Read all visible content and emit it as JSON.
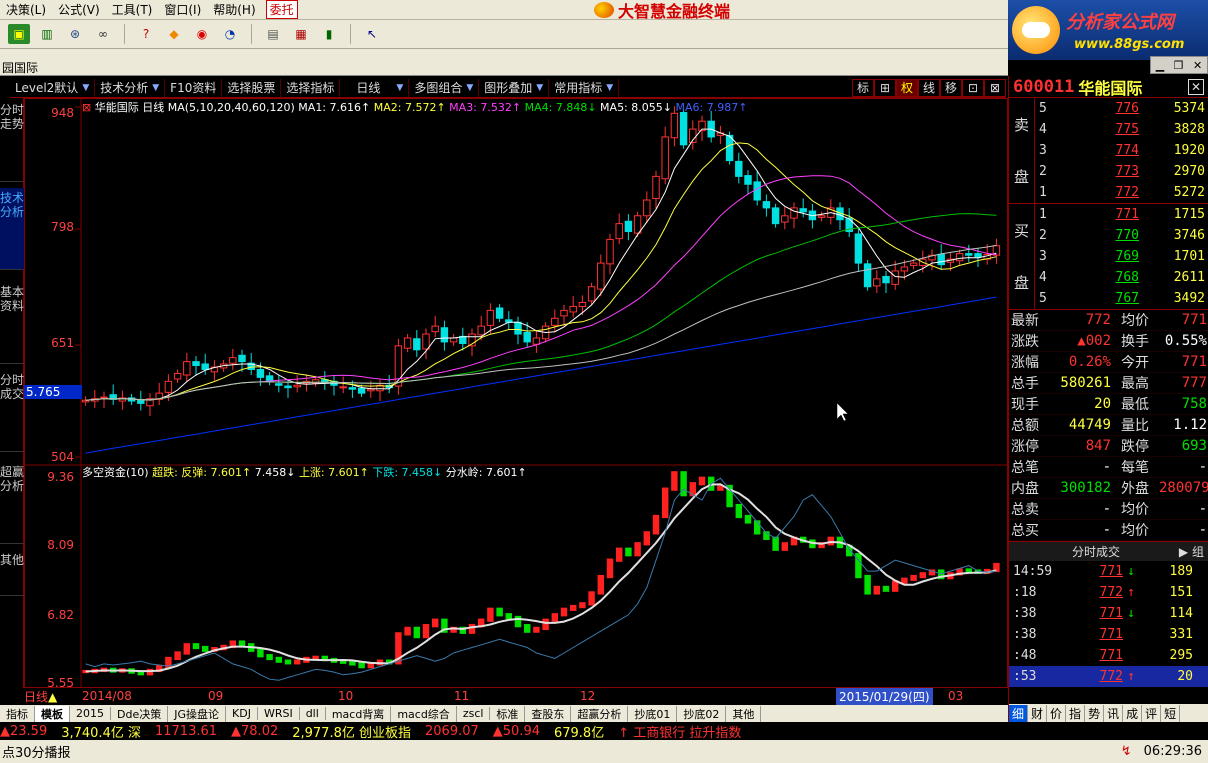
{
  "menu": {
    "items": [
      "决策(L)",
      "公式(V)",
      "工具(T)",
      "窗口(I)",
      "帮助(H)"
    ],
    "entrust": "委托"
  },
  "brand": {
    "title": "大智慧金融终端"
  },
  "ad": {
    "line1": "分析家公式网",
    "line2": "www.88gs.com"
  },
  "tabs": {
    "ghost": "园国际"
  },
  "toolbar": {
    "icons": [
      "monitor-icon",
      "stock-icon",
      "radar-icon",
      "binoculars-icon",
      "help-icon",
      "diamond-icon",
      "ring-icon",
      "f10-icon",
      "document-icon",
      "layout-icon",
      "bars-icon",
      "cursor-help-icon"
    ]
  },
  "chart_toolbar": {
    "items": [
      "Level2默认",
      "技术分析",
      "F10资料",
      "选择股票",
      "选择指标",
      "日线",
      "多图组合",
      "图形叠加",
      "常用指标"
    ],
    "buttons": [
      "标",
      "⊞",
      "权",
      "线",
      "移",
      "⊡",
      "⊠"
    ]
  },
  "side_tabs": [
    "分时走势",
    "技术分析",
    "基本资料",
    "分时成交",
    "超赢分析",
    "其他"
  ],
  "main_legend": {
    "title": "华能国际 日线",
    "params": "MA(5,10,20,40,60,120)",
    "ma1": "MA1: 7.616↑",
    "ma2": "MA2: 7.572↑",
    "ma3": "MA3: 7.532↑",
    "ma4": "MA4: 7.848↓",
    "ma5": "MA5: 8.055↓",
    "ma6": "MA6: 7.987↑"
  },
  "sub_legend": {
    "title": "多空资金(10)",
    "a": "超跌: 反弹: 7.601↑",
    "b": "7.458↓",
    "c": "上涨: 7.601↑",
    "d": "下跌: 7.458↓",
    "e": "分水岭: 7.601↑"
  },
  "price_axis": {
    "ticks": [
      "948",
      "798",
      "651",
      "504"
    ],
    "current": "5.765",
    "low_label": "5.78"
  },
  "sub_axis": {
    "ticks": [
      "9.36",
      "8.09",
      "6.82",
      "5.55"
    ]
  },
  "x_axis": {
    "labels": [
      "2014/08",
      "09",
      "10",
      "11",
      "12",
      "2015/01/29(四)",
      "03"
    ],
    "period": "日线"
  },
  "bottom_tabs": [
    "指标",
    "模板",
    "2015",
    "Dde决策",
    "JG操盘论",
    "KDJ",
    "WRSI",
    "dll",
    "macd背离",
    "macd综合",
    "zscl",
    "标准",
    "查股东",
    "超赢分析",
    "抄底01",
    "抄底02",
    "其他"
  ],
  "ticker": [
    {
      "text": "▲23.59",
      "color": "red"
    },
    {
      "text": "3,740.4亿 深",
      "color": "yellow"
    },
    {
      "text": "11713.61",
      "color": "red"
    },
    {
      "text": "▲78.02",
      "color": "red"
    },
    {
      "text": "2,977.8亿 创业板指",
      "color": "yellow"
    },
    {
      "text": "2069.07",
      "color": "red"
    },
    {
      "text": "▲50.94",
      "color": "red"
    },
    {
      "text": "679.8亿",
      "color": "yellow"
    },
    {
      "text": "↑ 工商银行 拉升指数",
      "color": "red"
    }
  ],
  "status": {
    "left": "点30分播报",
    "time": "06:29:36"
  },
  "quote": {
    "code": "600011",
    "name": "华能国际",
    "ask_label": [
      "卖",
      "盘"
    ],
    "bid_label": [
      "买",
      "盘"
    ],
    "asks": [
      {
        "lv": "5",
        "price": "776",
        "vol": "5374"
      },
      {
        "lv": "4",
        "price": "775",
        "vol": "3828"
      },
      {
        "lv": "3",
        "price": "774",
        "vol": "1920"
      },
      {
        "lv": "2",
        "price": "773",
        "vol": "2970"
      },
      {
        "lv": "1",
        "price": "772",
        "vol": "5272"
      }
    ],
    "bids": [
      {
        "lv": "1",
        "price": "771",
        "vol": "1715"
      },
      {
        "lv": "2",
        "price": "770",
        "vol": "3746"
      },
      {
        "lv": "3",
        "price": "769",
        "vol": "1701"
      },
      {
        "lv": "4",
        "price": "768",
        "vol": "2611"
      },
      {
        "lv": "5",
        "price": "767",
        "vol": "3492"
      }
    ],
    "stats": [
      {
        "k": "最新",
        "v": "772",
        "vc": "red",
        "k2": "均价",
        "v2": "771",
        "v2c": "red"
      },
      {
        "k": "涨跌",
        "v": "▲002",
        "vc": "red",
        "k2": "换手",
        "v2": "0.55%",
        "v2c": "white"
      },
      {
        "k": "涨幅",
        "v": "0.26%",
        "vc": "red",
        "k2": "今开",
        "v2": "771",
        "v2c": "red"
      },
      {
        "k": "总手",
        "v": "580261",
        "vc": "yellow",
        "k2": "最高",
        "v2": "777",
        "v2c": "red"
      },
      {
        "k": "现手",
        "v": "20",
        "vc": "yellow",
        "k2": "最低",
        "v2": "758",
        "v2c": "green"
      },
      {
        "k": "总额",
        "v": "44749",
        "vc": "yellow",
        "k2": "量比",
        "v2": "1.12",
        "v2c": "white"
      },
      {
        "k": "涨停",
        "v": "847",
        "vc": "red",
        "k2": "跌停",
        "v2": "693",
        "v2c": "green"
      },
      {
        "k": "总笔",
        "v": "-",
        "vc": "white",
        "k2": "每笔",
        "v2": "-",
        "v2c": "white"
      },
      {
        "k": "内盘",
        "v": "300182",
        "vc": "green",
        "k2": "外盘",
        "v2": "280079",
        "v2c": "red"
      },
      {
        "k": "总卖",
        "v": "-",
        "vc": "white",
        "k2": "均价",
        "v2": "-",
        "v2c": "white"
      },
      {
        "k": "总买",
        "v": "-",
        "vc": "white",
        "k2": "均价",
        "v2": "-",
        "v2c": "white"
      }
    ],
    "ticks_head": "分时成交",
    "ticks_btn": "组",
    "ticks": [
      {
        "t": "14:59",
        "p": "771",
        "d": "↓",
        "dc": "green",
        "q": "189",
        "sel": false
      },
      {
        "t": ":18",
        "p": "772",
        "d": "↑",
        "dc": "red",
        "q": "151",
        "sel": false
      },
      {
        "t": ":38",
        "p": "771",
        "d": "↓",
        "dc": "green",
        "q": "114",
        "sel": false
      },
      {
        "t": ":38",
        "p": "771",
        "d": "",
        "dc": "red",
        "q": "331",
        "sel": false
      },
      {
        "t": ":48",
        "p": "771",
        "d": "",
        "dc": "red",
        "q": "295",
        "sel": false
      },
      {
        "t": ":53",
        "p": "772",
        "d": "↑",
        "dc": "red",
        "q": "20",
        "sel": true
      }
    ],
    "tabs": [
      "细",
      "财",
      "价",
      "指",
      "势",
      "讯",
      "成",
      "评",
      "短"
    ]
  },
  "colors": {
    "up": "#ff3232",
    "down": "#00e0e0",
    "ma1": "#ffffff",
    "ma2": "#ffff40",
    "ma3": "#ff40ff",
    "ma4": "#00c000",
    "ma5": "#c0c0c0",
    "ma6": "#0030ff",
    "axis": "#800000"
  },
  "chart_data": [
    {
      "type": "candlestick",
      "title": "华能国际 日线",
      "ylim": [
        5.04,
        9.48
      ],
      "ma_periods": [
        5,
        10,
        20,
        40,
        60,
        120
      ],
      "x_labels": [
        "2014/08",
        "09",
        "10",
        "11",
        "12",
        "2015/01/29(四)",
        "03"
      ],
      "closes": [
        5.76,
        5.78,
        5.8,
        5.77,
        5.79,
        5.75,
        5.72,
        5.78,
        5.85,
        6.0,
        6.1,
        6.25,
        6.2,
        6.15,
        6.18,
        6.22,
        6.3,
        6.25,
        6.15,
        6.05,
        6.0,
        5.95,
        5.92,
        5.95,
        6.0,
        6.02,
        5.98,
        5.95,
        5.93,
        5.9,
        5.85,
        5.9,
        5.95,
        5.92,
        6.45,
        6.55,
        6.4,
        6.6,
        6.7,
        6.5,
        6.55,
        6.48,
        6.6,
        6.7,
        6.9,
        6.8,
        6.75,
        6.6,
        6.5,
        6.55,
        6.7,
        6.8,
        6.9,
        6.95,
        7.0,
        7.2,
        7.5,
        7.8,
        8.0,
        7.9,
        8.1,
        8.3,
        8.6,
        9.1,
        9.4,
        9.0,
        9.2,
        9.3,
        9.1,
        9.15,
        8.8,
        8.6,
        8.5,
        8.3,
        8.2,
        8.0,
        8.1,
        8.2,
        8.15,
        8.05,
        8.1,
        8.2,
        8.05,
        7.9,
        7.5,
        7.2,
        7.3,
        7.25,
        7.4,
        7.45,
        7.5,
        7.55,
        7.6,
        7.48,
        7.55,
        7.62,
        7.6,
        7.58,
        7.61,
        7.72
      ]
    },
    {
      "type": "line",
      "title": "多空资金(10)",
      "ylim": [
        5.55,
        9.36
      ],
      "series": [
        {
          "name": "超跌: 反弹",
          "values": [
            5.76,
            5.78,
            5.8,
            5.77,
            5.79,
            5.75,
            5.72,
            5.78,
            5.85,
            6.0,
            6.1,
            6.25,
            6.2,
            6.15,
            6.18,
            6.22,
            6.3,
            6.25,
            6.15,
            6.05,
            6.0,
            5.95,
            5.92,
            5.95,
            6.0,
            6.02,
            5.98,
            5.95,
            5.93,
            5.9,
            5.85,
            5.9,
            5.95,
            5.92,
            6.45,
            6.55,
            6.4,
            6.6,
            6.7,
            6.5,
            6.55,
            6.48,
            6.6,
            6.7,
            6.9,
            6.8,
            6.75,
            6.6,
            6.5,
            6.55,
            6.7,
            6.8,
            6.9,
            6.95,
            7.0,
            7.2,
            7.5,
            7.8,
            8.0,
            7.9,
            8.1,
            8.3,
            8.6,
            9.1,
            9.4,
            9.0,
            9.2,
            9.3,
            9.1,
            9.15,
            8.8,
            8.6,
            8.5,
            8.3,
            8.2,
            8.0,
            8.1,
            8.2,
            8.15,
            8.05,
            8.1,
            8.2,
            8.05,
            7.9,
            7.5,
            7.2,
            7.3,
            7.25,
            7.4,
            7.45,
            7.5,
            7.55,
            7.6,
            7.48,
            7.55,
            7.62,
            7.6,
            7.58,
            7.61,
            7.72
          ]
        },
        {
          "name": "分水岭",
          "values": [
            5.9,
            5.85,
            5.9,
            5.88,
            5.9,
            5.92,
            5.95,
            5.9,
            5.88,
            5.86,
            5.9,
            5.95,
            6.0,
            6.05,
            6.1,
            6.0,
            5.9,
            5.85,
            5.8,
            5.7,
            5.62,
            5.6,
            5.65,
            5.7,
            5.75,
            5.8,
            5.78,
            5.75,
            5.7,
            5.72,
            5.75,
            5.8,
            5.85,
            5.9,
            5.95,
            6.0,
            6.05,
            6.0,
            5.95,
            6.0,
            6.1,
            6.15,
            6.2,
            6.25,
            6.3,
            6.35,
            6.3,
            6.25,
            6.2,
            6.1,
            6.05,
            6.0,
            6.1,
            6.2,
            6.3,
            6.4,
            6.5,
            6.6,
            6.7,
            6.8,
            7.0,
            7.3,
            7.8,
            8.3,
            8.9,
            9.1,
            9.0,
            8.9,
            9.2,
            9.3,
            9.1,
            8.9,
            8.7,
            8.5,
            8.3,
            8.2,
            8.4,
            8.6,
            8.9,
            9.0,
            8.8,
            8.6,
            8.3,
            8.0,
            7.8,
            7.6,
            7.6,
            7.7,
            7.8,
            7.75,
            7.7,
            7.65,
            7.6,
            7.55,
            7.6,
            7.65,
            7.7,
            7.6,
            7.58,
            7.6
          ]
        }
      ]
    }
  ]
}
